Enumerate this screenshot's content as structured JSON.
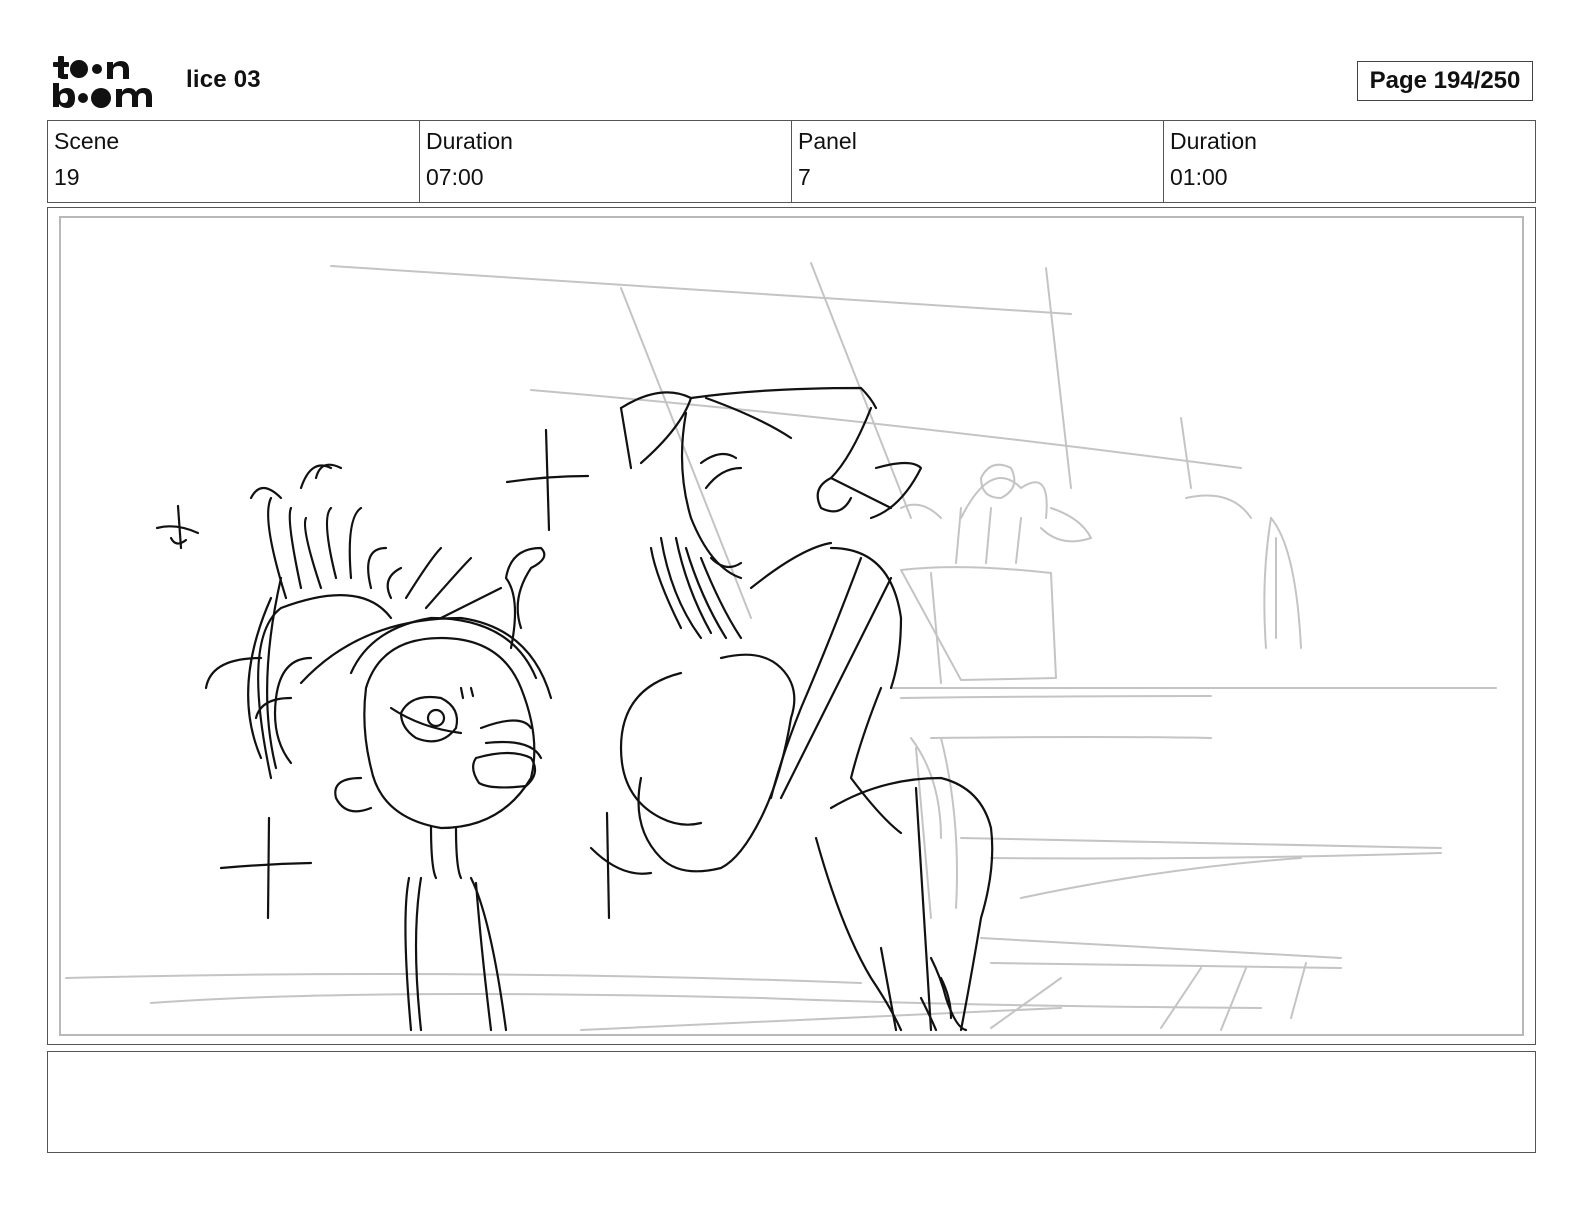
{
  "header": {
    "logo": {
      "name": "toonboom-logo",
      "top_text": "toon",
      "bottom_text": "boom"
    },
    "title": "lice 03",
    "page_label": "Page 194/250"
  },
  "info": {
    "scene_label": "Scene",
    "scene_value": "19",
    "scene_duration_label": "Duration",
    "scene_duration_value": "07:00",
    "panel_label": "Panel",
    "panel_value": "7",
    "panel_duration_label": "Duration",
    "panel_duration_value": "01:00"
  },
  "panel": {
    "image": "storyboard-sketch",
    "line_color": "#111111",
    "background_line_color": "#c4c4c4"
  },
  "notes": {
    "text": ""
  }
}
